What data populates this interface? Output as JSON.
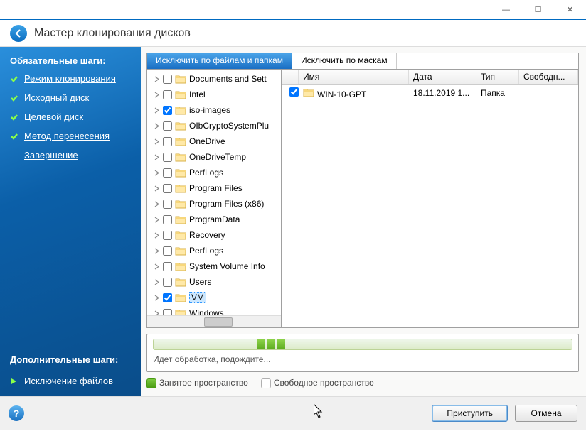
{
  "titlebar": {
    "min": "—",
    "max": "☐",
    "close": "✕"
  },
  "header": {
    "title": "Мастер клонирования дисков"
  },
  "sidebar": {
    "required_label": "Обязательные шаги:",
    "additional_label": "Дополнительные шаги:",
    "steps": [
      {
        "label": "Режим клонирования",
        "done": true
      },
      {
        "label": "Исходный диск",
        "done": true
      },
      {
        "label": "Целевой диск",
        "done": true
      },
      {
        "label": "Метод перенесения",
        "done": true
      },
      {
        "label": "Завершение",
        "done": false
      }
    ],
    "current": "Исключение файлов"
  },
  "tabs": {
    "by_files": "Исключить по файлам и папкам",
    "by_masks": "Исключить по маскам"
  },
  "tree": [
    {
      "label": "Documents and Sett",
      "checked": false,
      "special": true
    },
    {
      "label": "Intel",
      "checked": false
    },
    {
      "label": "iso-images",
      "checked": true
    },
    {
      "label": "OIbCryptoSystemPlu",
      "checked": false
    },
    {
      "label": "OneDrive",
      "checked": false
    },
    {
      "label": "OneDriveTemp",
      "checked": false
    },
    {
      "label": "PerfLogs",
      "checked": false
    },
    {
      "label": "Program Files",
      "checked": false
    },
    {
      "label": "Program Files (x86)",
      "checked": false
    },
    {
      "label": "ProgramData",
      "checked": false
    },
    {
      "label": "Recovery",
      "checked": false
    },
    {
      "label": "PerfLogs",
      "checked": false
    },
    {
      "label": "System Volume Info",
      "checked": false
    },
    {
      "label": "Users",
      "checked": false
    },
    {
      "label": "VM",
      "checked": true,
      "selected": true
    },
    {
      "label": "Windows",
      "checked": false
    }
  ],
  "list": {
    "col_name": "Имя",
    "col_date": "Дата",
    "col_type": "Тип",
    "col_free": "Свободн...",
    "rows": [
      {
        "name": "WIN-10-GPT",
        "date": "18.11.2019 1...",
        "type": "Папка",
        "checked": true
      }
    ]
  },
  "status": "Идет обработка, подождите...",
  "legend": {
    "used": "Занятое пространство",
    "free": "Свободное пространство"
  },
  "footer": {
    "proceed": "Приступить",
    "cancel": "Отмена"
  }
}
